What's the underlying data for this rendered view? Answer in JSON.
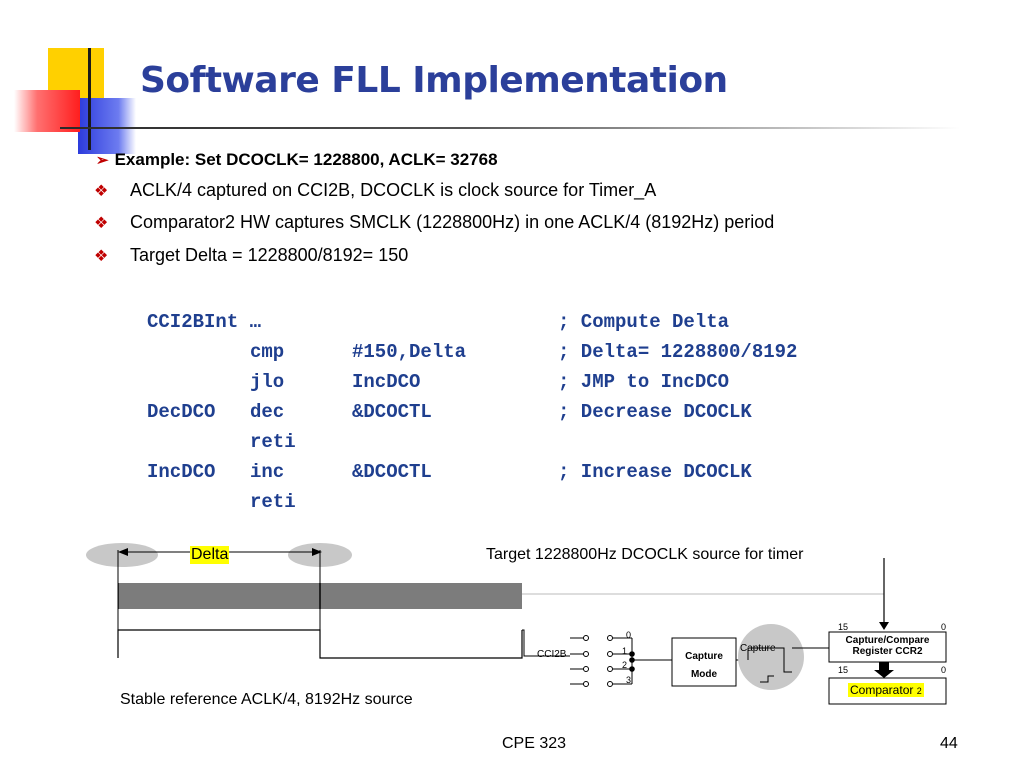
{
  "slide": {
    "title": "Software FLL Implementation",
    "main_bullet": "Example: Set DCOCLK= 1228800, ACLK= 32768",
    "sub_bullets": [
      "ACLK/4 captured on CCI2B, DCOCLK is clock source for Timer_A",
      "Comparator2 HW captures SMCLK (1228800Hz) in one ACLK/4 (8192Hz) period",
      "Target Delta = 1228800/8192= 150"
    ]
  },
  "code": [
    {
      "label": "CCI2BInt …",
      "op": "",
      "arg": "",
      "comment": "; Compute Delta"
    },
    {
      "label": "",
      "op": "cmp",
      "arg": "#150,Delta",
      "comment": "; Delta= 1228800/8192"
    },
    {
      "label": "",
      "op": "jlo",
      "arg": "IncDCO",
      "comment": "; JMP to IncDCO"
    },
    {
      "label": "DecDCO",
      "op": "dec",
      "arg": "&DCOCTL",
      "comment": "; Decrease DCOCLK"
    },
    {
      "label": "",
      "op": "reti",
      "arg": "",
      "comment": ""
    },
    {
      "label": "IncDCO",
      "op": "inc",
      "arg": "&DCOCTL",
      "comment": "; Increase DCOCLK"
    },
    {
      "label": "",
      "op": "reti",
      "arg": "",
      "comment": ""
    }
  ],
  "diagram": {
    "delta_label": "Delta",
    "target_label": "Target 1228800Hz DCOCLK source for timer",
    "reference_label": "Stable reference ACLK/4, 8192Hz source",
    "cci2b_label": "CCI2B",
    "mux_inputs": [
      "0",
      "1",
      "2",
      "3"
    ],
    "capture_mode": [
      "Capture",
      "Mode"
    ],
    "capture_label": "Capture",
    "register_bits_top": [
      "15",
      "0"
    ],
    "register_label": [
      "Capture/Compare",
      "Register CCR2"
    ],
    "register_bits_bottom": [
      "15",
      "0"
    ],
    "comparator_label": "Comparator",
    "comparator_number": "2"
  },
  "footer": {
    "course": "CPE 323",
    "page": "44"
  },
  "colors": {
    "title": "#2b3f9a",
    "code": "#1f3f8f",
    "bullet_mark": "#c00000",
    "highlight": "#ffff00",
    "ellipse": "#c8c8c8"
  }
}
